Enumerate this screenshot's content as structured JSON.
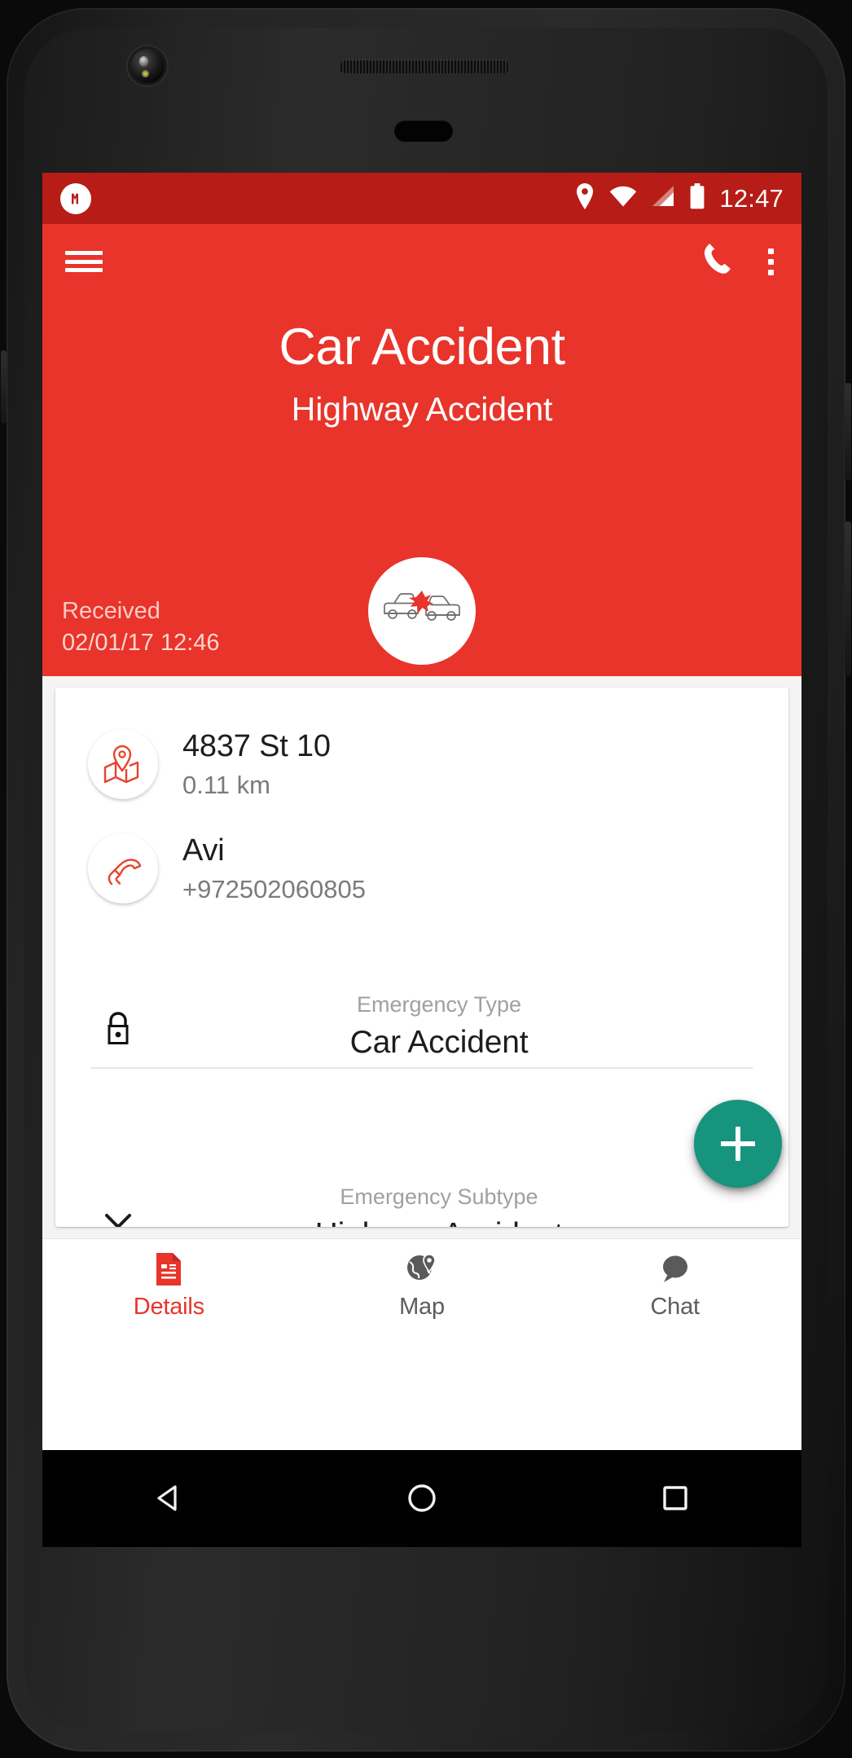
{
  "status_bar": {
    "app_icon": "app-notification-icon",
    "icons": [
      "location-pin-icon",
      "wifi-icon",
      "cellular-signal-icon",
      "battery-icon"
    ],
    "time": "12:47"
  },
  "app_bar": {
    "menu_icon": "hamburger-menu-icon",
    "call_icon": "phone-call-icon",
    "overflow_icon": "overflow-menu-icon"
  },
  "hero": {
    "title": "Car Accident",
    "subtitle": "Highway Accident",
    "received_label": "Received",
    "received_time": "02/01/17 12:46",
    "avatar_icon": "car-accident-icon",
    "background_color": "#e8342a"
  },
  "details": {
    "location": {
      "icon": "map-pin-icon",
      "address": "4837 St 10",
      "distance": "0.11 km"
    },
    "contact": {
      "icon": "phone-handset-icon",
      "name": "Avi",
      "phone": "+972502060805"
    },
    "emergency_type": {
      "icon": "lock-icon",
      "label": "Emergency Type",
      "value": "Car Accident"
    },
    "emergency_subtype": {
      "icon": "chevron-down-icon",
      "label": "Emergency Subtype",
      "value": "Highway Accident"
    },
    "fab": {
      "icon": "plus-icon",
      "color": "#16947d"
    }
  },
  "bottom_nav": {
    "active_color": "#e8342a",
    "items": [
      {
        "label": "Details",
        "icon": "document-icon",
        "active": true
      },
      {
        "label": "Map",
        "icon": "globe-map-icon",
        "active": false
      },
      {
        "label": "Chat",
        "icon": "chat-bubble-icon",
        "active": false
      }
    ]
  },
  "android_nav": {
    "back": "back-triangle-icon",
    "home": "home-circle-icon",
    "recents": "recents-square-icon"
  }
}
